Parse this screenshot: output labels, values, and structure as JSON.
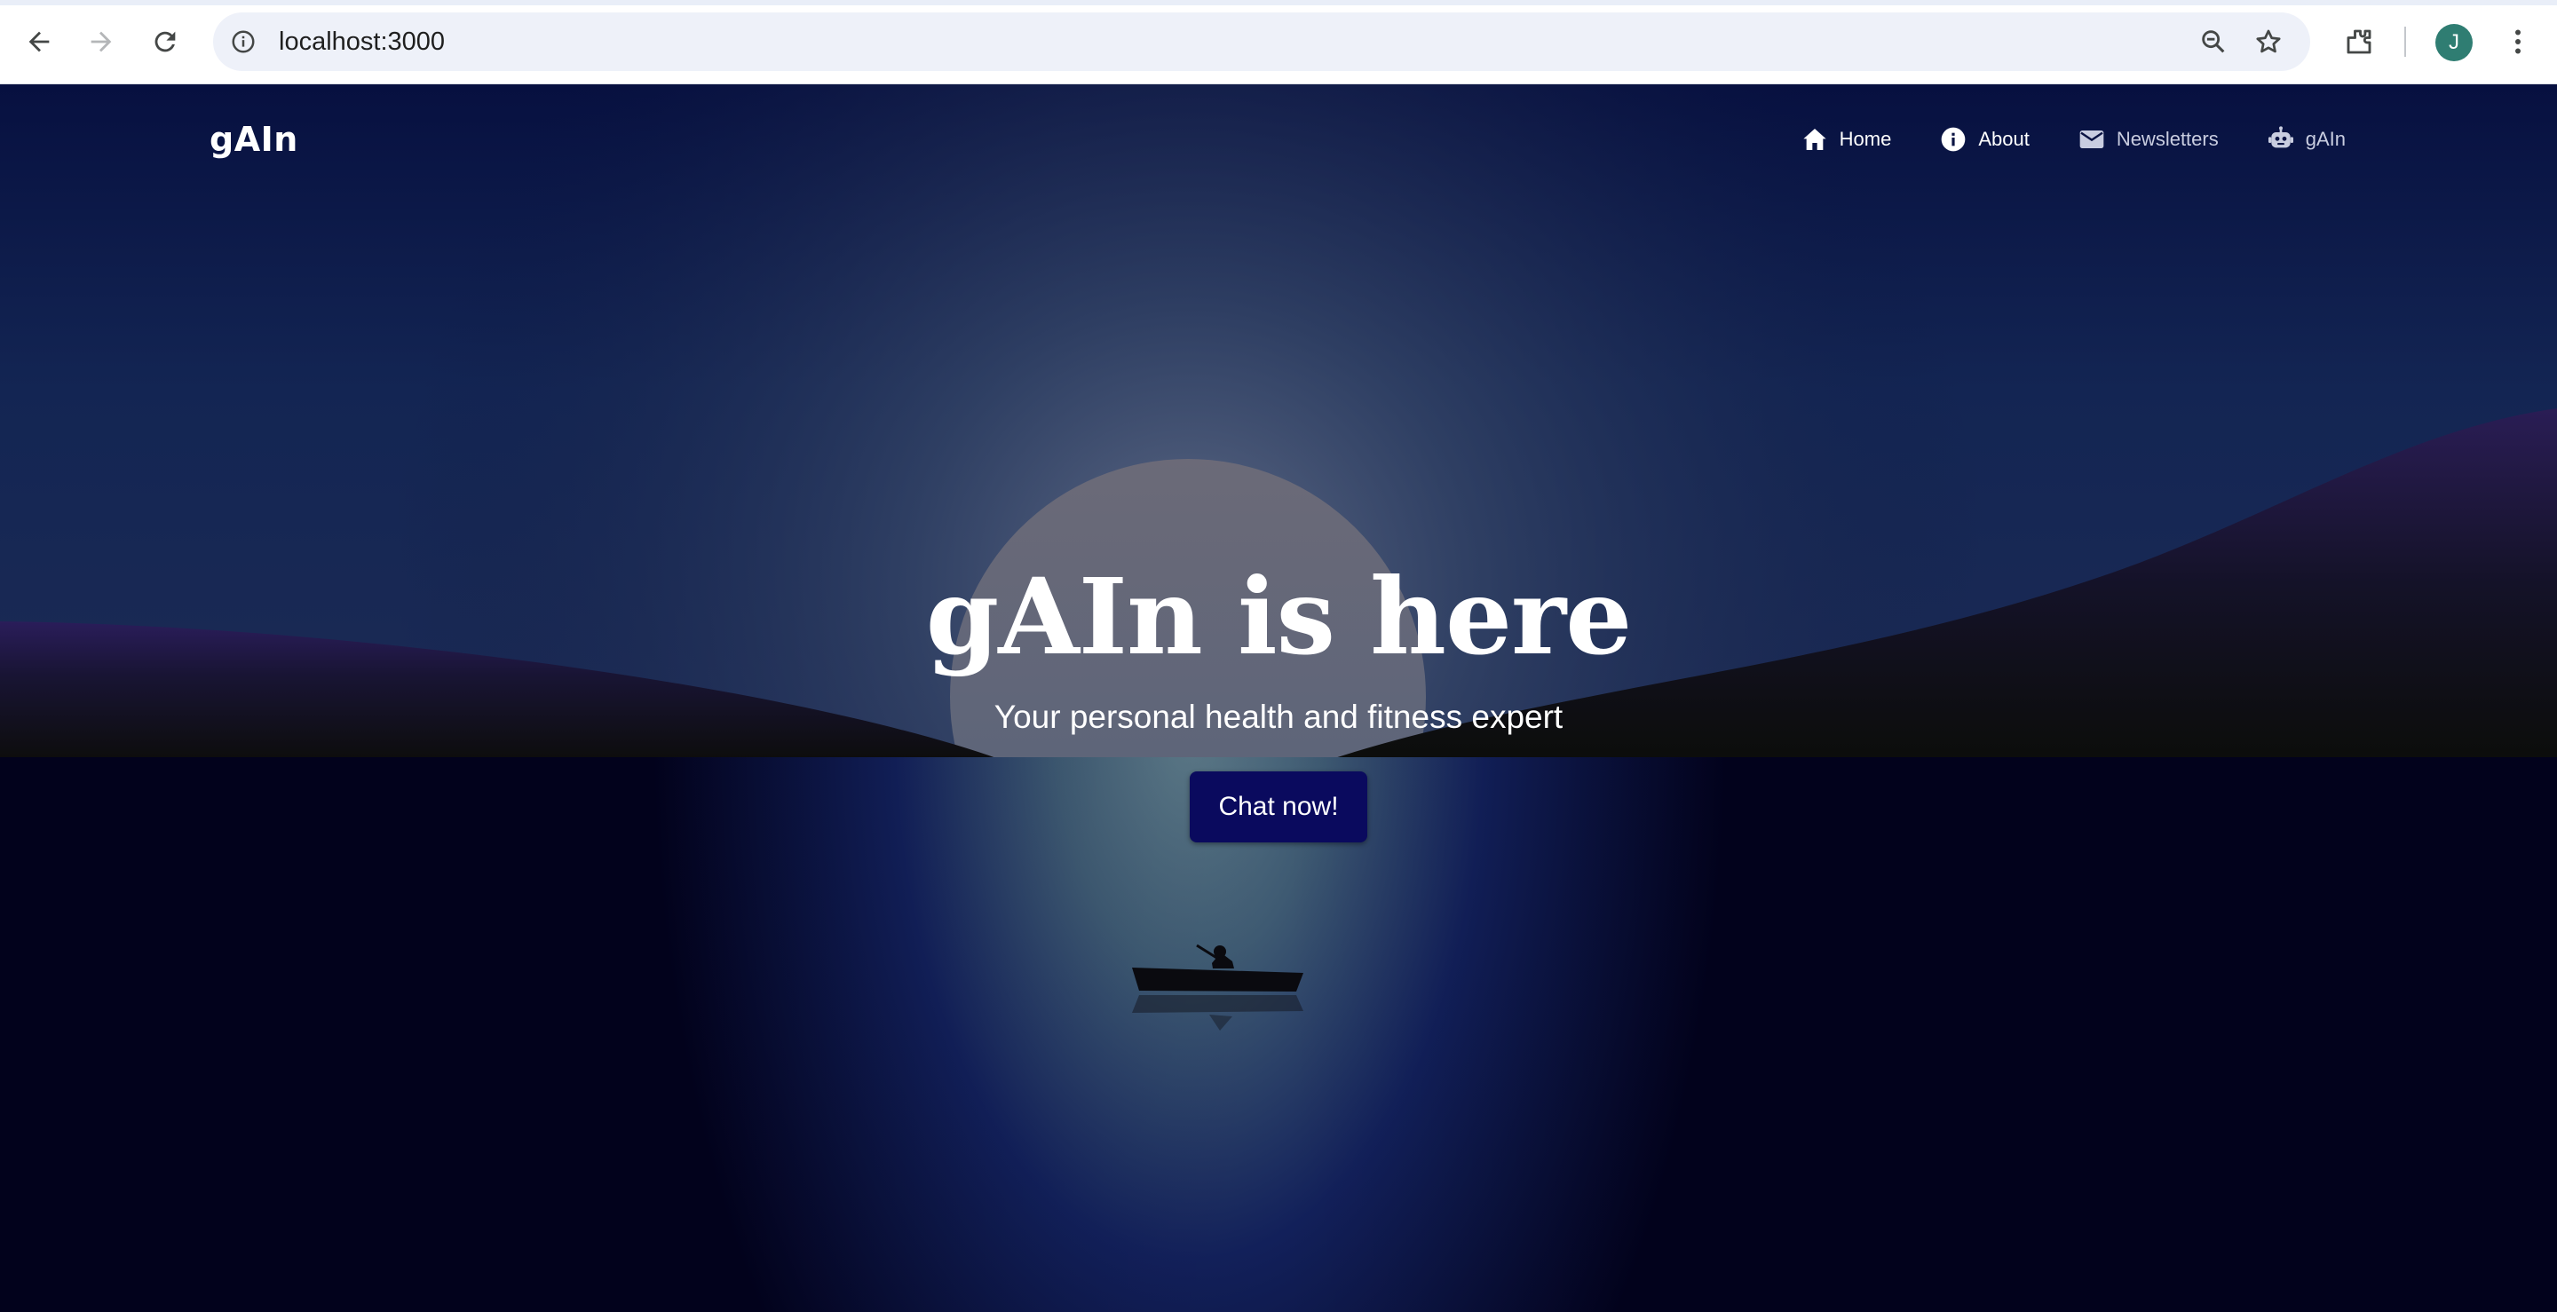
{
  "browser": {
    "url": "localhost:3000",
    "profile_initial": "J",
    "icons": {
      "back": "arrow-left-icon",
      "forward": "arrow-right-icon",
      "reload": "reload-icon",
      "site_info": "info-icon",
      "zoom": "zoom-out-icon",
      "bookmark": "star-icon",
      "extensions": "puzzle-icon",
      "menu": "kebab-menu-icon"
    }
  },
  "site": {
    "logo": "gAIn",
    "nav": [
      {
        "label": "Home",
        "icon": "home-icon"
      },
      {
        "label": "About",
        "icon": "info-icon"
      },
      {
        "label": "Newsletters",
        "icon": "mail-icon"
      },
      {
        "label": "gAIn",
        "icon": "robot-icon"
      }
    ]
  },
  "hero": {
    "title": "gAIn is here",
    "subtitle": "Your personal health and fitness expert",
    "cta_label": "Chat now!"
  },
  "colors": {
    "sky_top": "#0b1040",
    "water": "#02021c",
    "cta_bg": "#0a0a5e",
    "avatar_bg": "#2f7d72"
  }
}
